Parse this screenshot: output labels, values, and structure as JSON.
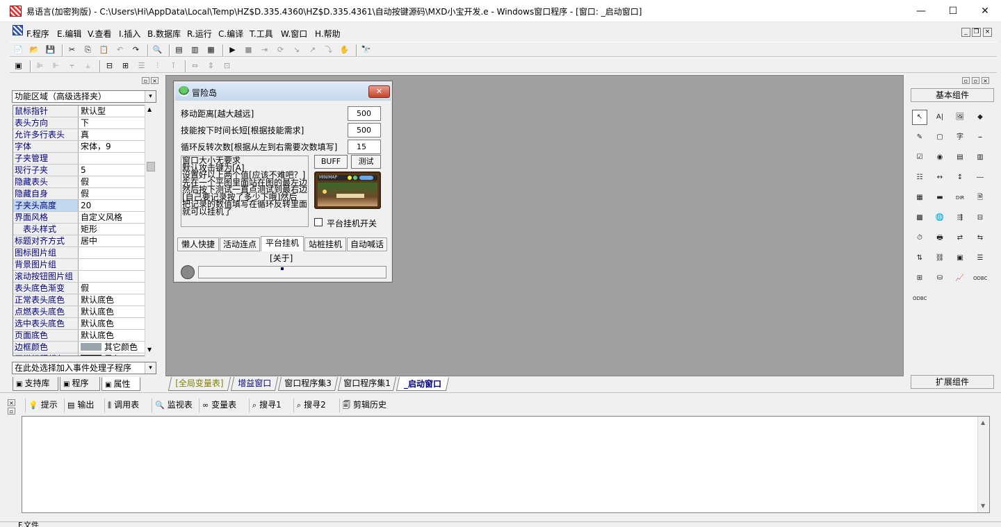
{
  "window": {
    "title": "易语言(加密狗版) - C:\\Users\\Hi\\AppData\\Local\\Temp\\HZ$D.335.4360\\HZ$D.335.4361\\自动按键源码\\MXD小宝开发.e - Windows窗口程序 - [窗口: _启动窗口]",
    "minimize": "—",
    "maximize": "☐",
    "close": "✕"
  },
  "menu": [
    "F.程序",
    "E.编辑",
    "V.查看",
    "I.插入",
    "B.数据库",
    "R.运行",
    "C.编译",
    "T.工具",
    "W.窗口",
    "H.帮助"
  ],
  "mdi": {
    "min": "_",
    "restore": "❐",
    "close": "×"
  },
  "panel_ctl": {
    "min": "▫",
    "close": "×",
    "down": "▾"
  },
  "toolbar1": [
    {
      "g": "📄",
      "n": "new-file-icon",
      "d": false
    },
    {
      "g": "📂",
      "n": "open-folder-icon",
      "d": false
    },
    {
      "g": "💾",
      "n": "save-icon",
      "d": false
    },
    {
      "sep": true
    },
    {
      "g": "✂",
      "n": "cut-icon",
      "d": false
    },
    {
      "g": "⎘",
      "n": "copy-icon",
      "d": false
    },
    {
      "g": "📋",
      "n": "paste-icon",
      "d": true
    },
    {
      "g": "↶",
      "n": "undo-icon",
      "d": true
    },
    {
      "g": "↷",
      "n": "redo-icon",
      "d": false
    },
    {
      "sep": true
    },
    {
      "g": "🔍",
      "n": "find-icon",
      "d": false
    },
    {
      "sep": true
    },
    {
      "g": "▤",
      "n": "layout1-icon",
      "d": false
    },
    {
      "g": "▥",
      "n": "layout2-icon",
      "d": false
    },
    {
      "g": "▦",
      "n": "layout3-icon",
      "d": false
    },
    {
      "sep": true
    },
    {
      "g": "▶",
      "n": "run-icon",
      "d": false
    },
    {
      "g": "■",
      "n": "stop-icon",
      "d": true
    },
    {
      "g": "⇥",
      "n": "step-icon",
      "d": true
    },
    {
      "g": "⟳",
      "n": "step-into-icon",
      "d": true
    },
    {
      "g": "↘",
      "n": "step-over-icon",
      "d": true
    },
    {
      "g": "↗",
      "n": "step-out-icon",
      "d": true
    },
    {
      "g": "⤵",
      "n": "run-to-icon",
      "d": true
    },
    {
      "g": "✋",
      "n": "hand-icon",
      "d": true
    },
    {
      "sep": true
    },
    {
      "g": "🔭",
      "n": "binoculars-icon",
      "d": false
    }
  ],
  "toolbar2": [
    {
      "g": "▣",
      "n": "form-icon",
      "d": false
    },
    {
      "sep": true
    },
    {
      "g": "⊫",
      "n": "align-left-icon",
      "d": true
    },
    {
      "g": "⊩",
      "n": "align-center-icon",
      "d": true
    },
    {
      "g": "⫧",
      "n": "align-top-icon",
      "d": true
    },
    {
      "g": "⫨",
      "n": "align-bottom-icon",
      "d": true
    },
    {
      "sep": true
    },
    {
      "g": "⊟",
      "n": "center-h-icon",
      "d": false
    },
    {
      "g": "⊞",
      "n": "center-v-icon",
      "d": false
    },
    {
      "g": "☰",
      "n": "space-h-icon",
      "d": true
    },
    {
      "g": "⫶",
      "n": "space-v-icon",
      "d": true
    },
    {
      "g": "⊺",
      "n": "space-even-icon",
      "d": true
    },
    {
      "sep": true
    },
    {
      "g": "⇔",
      "n": "same-width-icon",
      "d": true
    },
    {
      "g": "⇕",
      "n": "same-height-icon",
      "d": true
    },
    {
      "g": "⊡",
      "n": "same-size-icon",
      "d": true
    }
  ],
  "left_panel": {
    "area_combo": "功能区域（高级选择夹）",
    "event_combo": "在此处选择加入事件处理子程序",
    "properties": [
      {
        "k": "鼠标指针",
        "v": "默认型",
        "hl": true
      },
      {
        "k": "表头方向",
        "v": "下"
      },
      {
        "k": "允许多行表头",
        "v": "真"
      },
      {
        "k": "字体",
        "v": "宋体，9"
      },
      {
        "k": "子夹管理",
        "v": ""
      },
      {
        "k": "现行子夹",
        "v": "5"
      },
      {
        "k": "隐藏表头",
        "v": "假"
      },
      {
        "k": "隐藏自身",
        "v": "假"
      },
      {
        "k": "子夹头高度",
        "v": "20"
      },
      {
        "k": "界面风格",
        "v": "自定义风格"
      },
      {
        "k": "　表头样式",
        "v": "矩形"
      },
      {
        "k": "标题对齐方式",
        "v": "居中"
      },
      {
        "k": "图标图片组",
        "v": ""
      },
      {
        "k": "背景图片组",
        "v": ""
      },
      {
        "k": "滚动按钮图片组",
        "v": ""
      },
      {
        "k": "表头底色渐变",
        "v": "假"
      },
      {
        "k": "正常表头底色",
        "v": "默认底色"
      },
      {
        "k": "点燃表头底色",
        "v": "默认底色"
      },
      {
        "k": "选中表头底色",
        "v": "默认底色"
      },
      {
        "k": "页面底色",
        "v": "默认底色"
      },
      {
        "k": "边框颜色",
        "v": "其它颜色",
        "swatch": "#9aa4ae"
      },
      {
        "k": "正常标题颜色",
        "v": "黑色",
        "swatch": "#000000"
      }
    ],
    "tabs": [
      {
        "label": "支持库",
        "icon": "library-icon"
      },
      {
        "label": "程序",
        "icon": "program-icon"
      },
      {
        "label": "属性",
        "icon": "property-icon"
      }
    ]
  },
  "design_window": {
    "title": "冒险岛",
    "close": "✕",
    "rows": [
      {
        "label": "移动距离[越大越远]",
        "value": "500"
      },
      {
        "label": "技能按下时间长短[根据技能需求]",
        "value": "500"
      },
      {
        "label": "循环反转次数[根据从左到右需要次数填写]",
        "value": "15"
      }
    ],
    "notes": "窗口大小无要求\n默认攻击键为[A]\n设置好以上两个值[应该不难吧？]\n先在一个平图里面站在图的最左边\n然后按下测试一直点测试到最右边\n[自己要记录按了多少下哦]然后\n把记录的数值填写在循环反转里面\n就可以挂机了",
    "buff_btn": "BUFF",
    "test_btn": "测试",
    "game_hud": "MINIMAP",
    "checkbox": "平台挂机开关",
    "tabs": [
      "懒人快捷",
      "活动连点",
      "平台挂机",
      "站桩挂机",
      "自动喊话"
    ],
    "about": "[关于]"
  },
  "doc_tabs": [
    {
      "label": "[全局变量表]",
      "color": "#808000"
    },
    {
      "label": "增益窗口",
      "color": "#000080"
    },
    {
      "label": "窗口程序集3",
      "color": "#000000"
    },
    {
      "label": "窗口程序集1",
      "color": "#000000"
    },
    {
      "label": "_启动窗口",
      "color": "#000080"
    }
  ],
  "right_panel": {
    "basic": "基本组件",
    "ext": "扩展组件",
    "icons": [
      [
        "arrow-pointer-icon",
        "↖"
      ],
      [
        "label-icon",
        "A|"
      ],
      [
        "picture-box-icon",
        "🖼"
      ],
      [
        "shape-icon",
        "◆"
      ],
      [
        "edit-box-icon",
        "✎"
      ],
      [
        "pic-box-icon",
        "▢"
      ],
      [
        "text-icon",
        "字"
      ],
      [
        "frame-icon",
        "⎯"
      ],
      [
        "checkbox-icon",
        "☑"
      ],
      [
        "radio-icon",
        "◉"
      ],
      [
        "list-box-icon",
        "▤"
      ],
      [
        "combo-box-icon",
        "▥"
      ],
      [
        "list-box2-icon",
        "☷"
      ],
      [
        "scroll-h-icon",
        "↔"
      ],
      [
        "scroll-v-icon",
        "↕"
      ],
      [
        "line-icon",
        "―"
      ],
      [
        "calendar-icon",
        "▦"
      ],
      [
        "ok-icon",
        "▬"
      ],
      [
        "dir-icon",
        "DIR"
      ],
      [
        "file-icon",
        "🗎"
      ],
      [
        "grid-icon",
        "▩"
      ],
      [
        "globe-icon",
        "🌐"
      ],
      [
        "tab-icon",
        "⇶"
      ],
      [
        "toolbar-icon",
        "⊟"
      ],
      [
        "timer-icon",
        "⏱"
      ],
      [
        "printer-icon",
        "🖶"
      ],
      [
        "net-icon",
        "⇄"
      ],
      [
        "net2-icon",
        "⇆"
      ],
      [
        "client-icon",
        "⇅"
      ],
      [
        "server-icon",
        "⛓"
      ],
      [
        "table-icon",
        "▣"
      ],
      [
        "db-icon",
        "☰"
      ],
      [
        "db2-icon",
        "⊞"
      ],
      [
        "db3-icon",
        "⛁"
      ],
      [
        "chart-icon",
        "📈"
      ],
      [
        "odbc-icon",
        "ODBC"
      ],
      [
        "odbc2-icon",
        "ODBC"
      ]
    ]
  },
  "bottom_tabs": [
    {
      "label": "提示",
      "icon": "hint-icon",
      "g": "💡"
    },
    {
      "label": "输出",
      "icon": "output-icon",
      "g": "▤"
    },
    {
      "label": "调用表",
      "icon": "call-table-icon",
      "g": "⫼"
    },
    {
      "label": "监视表",
      "icon": "watch-icon",
      "g": "🔍"
    },
    {
      "label": "变量表",
      "icon": "variable-icon",
      "g": "∞"
    },
    {
      "label": "搜寻1",
      "icon": "search1-icon",
      "g": "⌕"
    },
    {
      "label": "搜寻2",
      "icon": "search2-icon",
      "g": "⌕"
    },
    {
      "label": "剪辑历史",
      "icon": "clip-history-icon",
      "g": "🗐"
    }
  ],
  "status": "F.文件"
}
